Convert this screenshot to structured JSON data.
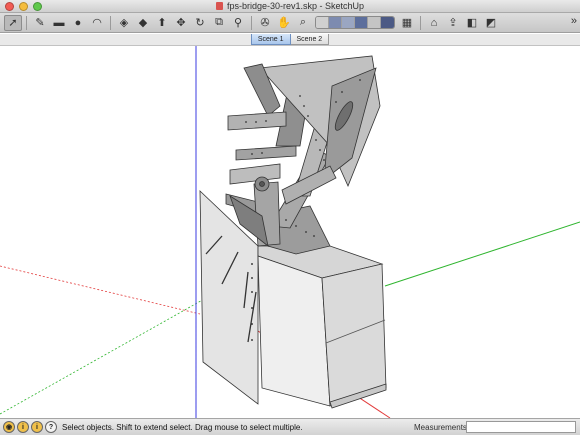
{
  "window": {
    "title": "fps-bridge-30-rev1.skp - SketchUp"
  },
  "toolbar": {
    "tools": [
      {
        "name": "select-tool",
        "glyph": "➚"
      },
      {
        "name": "pencil-tool",
        "glyph": "✎"
      },
      {
        "name": "rectangle-tool",
        "glyph": "▬"
      },
      {
        "name": "circle-tool",
        "glyph": "●"
      },
      {
        "name": "arc-tool",
        "glyph": "◠"
      },
      {
        "name": "eraser-tool",
        "glyph": "◈"
      },
      {
        "name": "paint-tool",
        "glyph": "◆"
      },
      {
        "name": "push-pull-tool",
        "glyph": "⬆"
      },
      {
        "name": "move-tool",
        "glyph": "✥"
      },
      {
        "name": "rotate-tool",
        "glyph": "↻"
      },
      {
        "name": "offset-tool",
        "glyph": "⧉"
      },
      {
        "name": "tape-measure-tool",
        "glyph": "⚲"
      },
      {
        "name": "orbit-tool",
        "glyph": "✇"
      },
      {
        "name": "pan-tool",
        "glyph": "✋"
      },
      {
        "name": "zoom-tool",
        "glyph": "⌕"
      }
    ],
    "right_tools": [
      {
        "name": "section-tool",
        "glyph": "▦"
      },
      {
        "name": "get-models-tool",
        "glyph": "⌂"
      },
      {
        "name": "share-model-tool",
        "glyph": "⇪"
      },
      {
        "name": "component-tool",
        "glyph": "◧"
      },
      {
        "name": "styles-tool",
        "glyph": "◩"
      }
    ],
    "more_label": "»"
  },
  "scenes": {
    "tabs": [
      "Scene 1",
      "Scene 2"
    ],
    "active": "Scene 1"
  },
  "viewport": {
    "axis_colors": {
      "red": "#e23b3b",
      "green": "#2fb52f",
      "blue": "#3b3be2"
    }
  },
  "statusbar": {
    "icons": [
      {
        "name": "geo-location-icon",
        "glyph": "◉"
      },
      {
        "name": "credits-icon",
        "glyph": "i"
      },
      {
        "name": "info-icon",
        "glyph": "i"
      },
      {
        "name": "help-icon",
        "glyph": "?"
      }
    ],
    "message": "Select objects. Shift to extend select. Drag mouse to select multiple.",
    "measurements_label": "Measurements",
    "measurements_value": ""
  }
}
